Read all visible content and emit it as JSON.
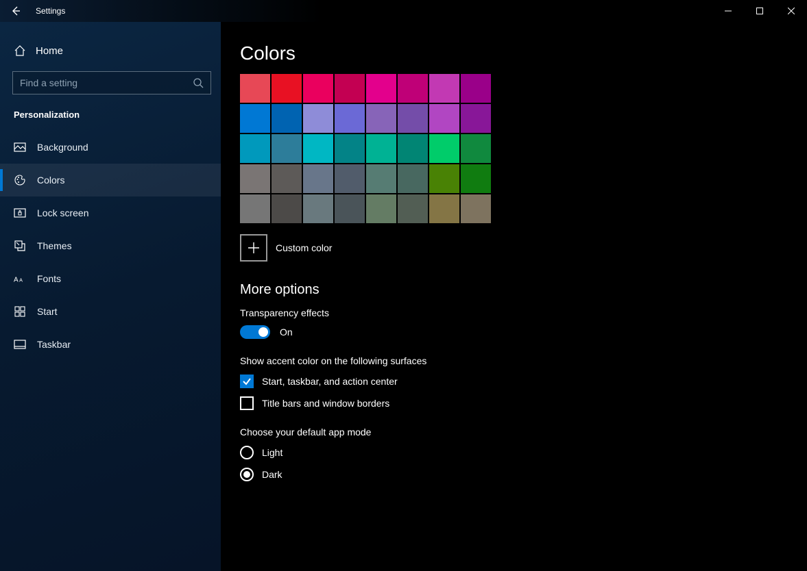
{
  "app_name": "Settings",
  "home_label": "Home",
  "search_placeholder": "Find a setting",
  "category_title": "Personalization",
  "nav": [
    {
      "label": "Background"
    },
    {
      "label": "Colors"
    },
    {
      "label": "Lock screen"
    },
    {
      "label": "Themes"
    },
    {
      "label": "Fonts"
    },
    {
      "label": "Start"
    },
    {
      "label": "Taskbar"
    }
  ],
  "page_title": "Colors",
  "color_rows": [
    [
      "#e74856",
      "#e81123",
      "#ea005e",
      "#c30052",
      "#e3008c",
      "#bf0077",
      "#c239b3",
      "#9a0089"
    ],
    [
      "#0078d4",
      "#0063b1",
      "#8e8cd8",
      "#6b69d6",
      "#8764b8",
      "#744da9",
      "#b146c2",
      "#881798"
    ],
    [
      "#0099bc",
      "#2d7d9a",
      "#00b7c3",
      "#038387",
      "#00b294",
      "#018574",
      "#00cc6a",
      "#10893e"
    ],
    [
      "#7a7574",
      "#5d5a58",
      "#68768a",
      "#515c6b",
      "#567c73",
      "#486860",
      "#498205",
      "#107c10"
    ],
    [
      "#767676",
      "#4c4a48",
      "#69797e",
      "#4a5459",
      "#647c64",
      "#525e54",
      "#847545",
      "#7e735f"
    ]
  ],
  "custom_color_label": "Custom color",
  "more_options_title": "More options",
  "transparency_label": "Transparency effects",
  "transparency_state": "On",
  "accent_surfaces_label": "Show accent color on the following surfaces",
  "check_start_label": "Start, taskbar, and action center",
  "check_titlebars_label": "Title bars and window borders",
  "app_mode_label": "Choose your default app mode",
  "mode_light_label": "Light",
  "mode_dark_label": "Dark"
}
